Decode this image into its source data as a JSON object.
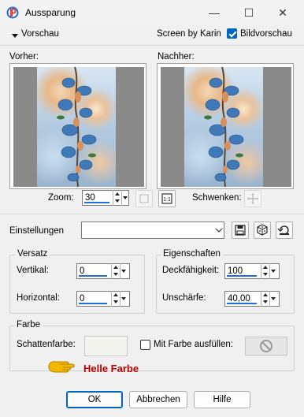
{
  "window": {
    "title": "Aussparung",
    "minimize_glyph": "—",
    "maximize_glyph": "☐",
    "close_glyph": "✕"
  },
  "preview_bar": {
    "toggle_label": "Vorschau",
    "credit": "Screen by Karin",
    "image_preview_label": "Bildvorschau",
    "image_preview_checked": true
  },
  "previews": {
    "before_label": "Vorher:",
    "after_label": "Nachher:"
  },
  "zoom": {
    "label": "Zoom:",
    "value": "30",
    "pan_label": "Schwenken:"
  },
  "settings": {
    "label": "Einstellungen",
    "preset_value": ""
  },
  "versatz": {
    "title": "Versatz",
    "vertical_label": "Vertikal:",
    "vertical_value": "0",
    "horizontal_label": "Horizontal:",
    "horizontal_value": "0"
  },
  "eigenschaften": {
    "title": "Eigenschaften",
    "opacity_label": "Deckfähigkeit:",
    "opacity_value": "100",
    "blur_label": "Unschärfe:",
    "blur_value": "40,00"
  },
  "farbe": {
    "title": "Farbe",
    "shadow_color_label": "Schattenfarbe:",
    "shadow_color": "#f4f4ef",
    "fill_label": "Mit Farbe ausfüllen:",
    "fill_checked": false,
    "annotation": "Helle Farbe",
    "annotation_color": "#c00000"
  },
  "buttons": {
    "ok": "OK",
    "cancel": "Abbrechen",
    "help": "Hilfe"
  },
  "colors": {
    "accent": "#0067c0",
    "field_underline": "#1e6fd9",
    "hand_icon": "#f5b800"
  },
  "icons": {
    "app": "psp-app-icon",
    "zoom_fit": "zoom-fit-icon",
    "zoom_actual": "zoom-actual-size-icon",
    "pan": "pan-move-icon",
    "save_preset": "save-icon",
    "random_preset": "dice-icon",
    "reset": "reset-icon",
    "no_color": "no-color-icon",
    "pointer": "pointing-hand-icon"
  }
}
